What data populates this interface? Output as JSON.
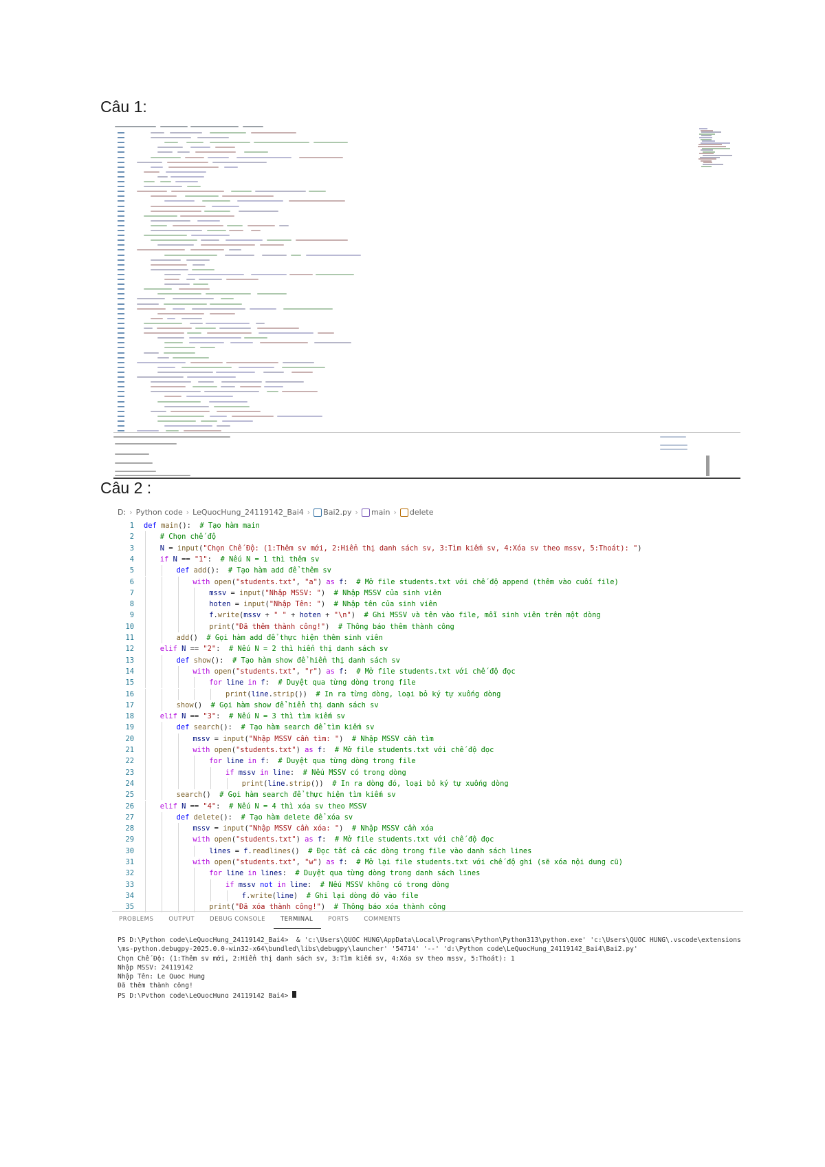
{
  "headings": {
    "q1": "Câu 1:",
    "q2": "Câu 2 :"
  },
  "editor2": {
    "breadcrumb": [
      "D:",
      "Python code",
      "LeQuocHung_24119142_Bai4",
      "Bai2.py",
      "main",
      "delete"
    ],
    "lines": [
      {
        "n": "1",
        "indent": 0,
        "code": [
          [
            "kw",
            "def "
          ],
          [
            "fn",
            "main"
          ],
          [
            "",
            "():  "
          ],
          [
            "cm",
            "# Tạo hàm main"
          ]
        ]
      },
      {
        "n": "2",
        "indent": 1,
        "code": [
          [
            "cm",
            "# Chọn chế độ"
          ]
        ]
      },
      {
        "n": "3",
        "indent": 1,
        "code": [
          [
            "var",
            "N"
          ],
          [
            "",
            " = "
          ],
          [
            "fn",
            "input"
          ],
          [
            "",
            "("
          ],
          [
            "str",
            "\"Chọn Chế Độ: (1:Thêm sv mới, 2:Hiển thị danh sách sv, 3:Tìm kiếm sv, 4:Xóa sv theo mssv, 5:Thoát): \""
          ],
          [
            "",
            ")"
          ]
        ]
      },
      {
        "n": "4",
        "indent": 1,
        "code": [
          [
            "kw2",
            "if "
          ],
          [
            "var",
            "N"
          ],
          [
            "",
            " == "
          ],
          [
            "str",
            "\"1\""
          ],
          [
            "",
            ":  "
          ],
          [
            "cm",
            "# Nếu N = 1 thì thêm sv"
          ]
        ]
      },
      {
        "n": "5",
        "indent": 2,
        "code": [
          [
            "kw",
            "def "
          ],
          [
            "fn",
            "add"
          ],
          [
            "",
            "():  "
          ],
          [
            "cm",
            "# Tạo hàm add để thêm sv"
          ]
        ]
      },
      {
        "n": "6",
        "indent": 3,
        "code": [
          [
            "kw2",
            "with "
          ],
          [
            "fn",
            "open"
          ],
          [
            "",
            "("
          ],
          [
            "str",
            "\"students.txt\""
          ],
          [
            "",
            ", "
          ],
          [
            "str",
            "\"a\""
          ],
          [
            "",
            ") "
          ],
          [
            "kw2",
            "as "
          ],
          [
            "var",
            "f"
          ],
          [
            "",
            ":  "
          ],
          [
            "cm",
            "# Mở file students.txt với chế độ append (thêm vào cuối file)"
          ]
        ]
      },
      {
        "n": "7",
        "indent": 4,
        "code": [
          [
            "var",
            "mssv"
          ],
          [
            "",
            " = "
          ],
          [
            "fn",
            "input"
          ],
          [
            "",
            "("
          ],
          [
            "str",
            "\"Nhập MSSV: \""
          ],
          [
            "",
            ")  "
          ],
          [
            "cm",
            "# Nhập MSSV của sinh viên"
          ]
        ]
      },
      {
        "n": "8",
        "indent": 4,
        "code": [
          [
            "var",
            "hoten"
          ],
          [
            "",
            " = "
          ],
          [
            "fn",
            "input"
          ],
          [
            "",
            "("
          ],
          [
            "str",
            "\"Nhập Tên: \""
          ],
          [
            "",
            ")  "
          ],
          [
            "cm",
            "# Nhập tên của sinh viên"
          ]
        ]
      },
      {
        "n": "9",
        "indent": 4,
        "code": [
          [
            "var",
            "f"
          ],
          [
            "",
            "."
          ],
          [
            "fn",
            "write"
          ],
          [
            "",
            "("
          ],
          [
            "var",
            "mssv"
          ],
          [
            "",
            " + "
          ],
          [
            "str",
            "\" \""
          ],
          [
            "",
            " + "
          ],
          [
            "var",
            "hoten"
          ],
          [
            "",
            " + "
          ],
          [
            "str",
            "\"\\n\""
          ],
          [
            "",
            ")  "
          ],
          [
            "cm",
            "# Ghi MSSV và tên vào file, mỗi sinh viên trên một dòng"
          ]
        ]
      },
      {
        "n": "10",
        "indent": 4,
        "code": [
          [
            "fn",
            "print"
          ],
          [
            "",
            "("
          ],
          [
            "str",
            "\"Đã thêm thành công!\""
          ],
          [
            "",
            ")  "
          ],
          [
            "cm",
            "# Thông báo thêm thành công"
          ]
        ]
      },
      {
        "n": "11",
        "indent": 2,
        "code": [
          [
            "fn",
            "add"
          ],
          [
            "",
            "()  "
          ],
          [
            "cm",
            "# Gọi hàm add để thực hiện thêm sinh viên"
          ]
        ]
      },
      {
        "n": "12",
        "indent": 1,
        "code": [
          [
            "kw2",
            "elif "
          ],
          [
            "var",
            "N"
          ],
          [
            "",
            " == "
          ],
          [
            "str",
            "\"2\""
          ],
          [
            "",
            ":  "
          ],
          [
            "cm",
            "# Nếu N = 2 thì hiển thị danh sách sv"
          ]
        ]
      },
      {
        "n": "13",
        "indent": 2,
        "code": [
          [
            "kw",
            "def "
          ],
          [
            "fn",
            "show"
          ],
          [
            "",
            "():  "
          ],
          [
            "cm",
            "# Tạo hàm show để hiển thị danh sách sv"
          ]
        ]
      },
      {
        "n": "14",
        "indent": 3,
        "code": [
          [
            "kw2",
            "with "
          ],
          [
            "fn",
            "open"
          ],
          [
            "",
            "("
          ],
          [
            "str",
            "\"students.txt\""
          ],
          [
            "",
            ", "
          ],
          [
            "str",
            "\"r\""
          ],
          [
            "",
            ") "
          ],
          [
            "kw2",
            "as "
          ],
          [
            "var",
            "f"
          ],
          [
            "",
            ":  "
          ],
          [
            "cm",
            "# Mở file students.txt với chế độ đọc"
          ]
        ]
      },
      {
        "n": "15",
        "indent": 4,
        "code": [
          [
            "kw2",
            "for "
          ],
          [
            "var",
            "line"
          ],
          [
            "kw2",
            " in "
          ],
          [
            "var",
            "f"
          ],
          [
            "",
            ":  "
          ],
          [
            "cm",
            "# Duyệt qua từng dòng trong file"
          ]
        ]
      },
      {
        "n": "16",
        "indent": 5,
        "code": [
          [
            "fn",
            "print"
          ],
          [
            "",
            "("
          ],
          [
            "var",
            "line"
          ],
          [
            "",
            "."
          ],
          [
            "fn",
            "strip"
          ],
          [
            "",
            "())  "
          ],
          [
            "cm",
            "# In ra từng dòng, loại bỏ ký tự xuống dòng"
          ]
        ]
      },
      {
        "n": "17",
        "indent": 2,
        "code": [
          [
            "fn",
            "show"
          ],
          [
            "",
            "()  "
          ],
          [
            "cm",
            "# Gọi hàm show để hiển thị danh sách sv"
          ]
        ]
      },
      {
        "n": "18",
        "indent": 1,
        "code": [
          [
            "kw2",
            "elif "
          ],
          [
            "var",
            "N"
          ],
          [
            "",
            " == "
          ],
          [
            "str",
            "\"3\""
          ],
          [
            "",
            ":  "
          ],
          [
            "cm",
            "# Nếu N = 3 thì tìm kiếm sv"
          ]
        ]
      },
      {
        "n": "19",
        "indent": 2,
        "code": [
          [
            "kw",
            "def "
          ],
          [
            "fn",
            "search"
          ],
          [
            "",
            "():  "
          ],
          [
            "cm",
            "# Tạo hàm search để tìm kiếm sv"
          ]
        ]
      },
      {
        "n": "20",
        "indent": 3,
        "code": [
          [
            "var",
            "mssv"
          ],
          [
            "",
            " = "
          ],
          [
            "fn",
            "input"
          ],
          [
            "",
            "("
          ],
          [
            "str",
            "\"Nhập MSSV cần tìm: \""
          ],
          [
            "",
            ")  "
          ],
          [
            "cm",
            "# Nhập MSSV cần tìm"
          ]
        ]
      },
      {
        "n": "21",
        "indent": 3,
        "code": [
          [
            "kw2",
            "with "
          ],
          [
            "fn",
            "open"
          ],
          [
            "",
            "("
          ],
          [
            "str",
            "\"students.txt\""
          ],
          [
            "",
            ") "
          ],
          [
            "kw2",
            "as "
          ],
          [
            "var",
            "f"
          ],
          [
            "",
            ":  "
          ],
          [
            "cm",
            "# Mở file students.txt với chế độ đọc"
          ]
        ]
      },
      {
        "n": "22",
        "indent": 4,
        "code": [
          [
            "kw2",
            "for "
          ],
          [
            "var",
            "line"
          ],
          [
            "kw2",
            " in "
          ],
          [
            "var",
            "f"
          ],
          [
            "",
            ":  "
          ],
          [
            "cm",
            "# Duyệt qua từng dòng trong file"
          ]
        ]
      },
      {
        "n": "23",
        "indent": 5,
        "code": [
          [
            "kw2",
            "if "
          ],
          [
            "var",
            "mssv"
          ],
          [
            "kw2",
            " in "
          ],
          [
            "var",
            "line"
          ],
          [
            "",
            ":  "
          ],
          [
            "cm",
            "# Nếu MSSV có trong dòng"
          ]
        ]
      },
      {
        "n": "24",
        "indent": 6,
        "code": [
          [
            "fn",
            "print"
          ],
          [
            "",
            "("
          ],
          [
            "var",
            "line"
          ],
          [
            "",
            "."
          ],
          [
            "fn",
            "strip"
          ],
          [
            "",
            "())  "
          ],
          [
            "cm",
            "# In ra dòng đó, loại bỏ ký tự xuống dòng"
          ]
        ]
      },
      {
        "n": "25",
        "indent": 2,
        "code": [
          [
            "fn",
            "search"
          ],
          [
            "",
            "()  "
          ],
          [
            "cm",
            "# Gọi hàm search để thực hiện tìm kiếm sv"
          ]
        ]
      },
      {
        "n": "26",
        "indent": 1,
        "code": [
          [
            "kw2",
            "elif "
          ],
          [
            "var",
            "N"
          ],
          [
            "",
            " == "
          ],
          [
            "str",
            "\"4\""
          ],
          [
            "",
            ":  "
          ],
          [
            "cm",
            "# Nếu N = 4 thì xóa sv theo MSSV"
          ]
        ]
      },
      {
        "n": "27",
        "indent": 2,
        "code": [
          [
            "kw",
            "def "
          ],
          [
            "fn",
            "delete"
          ],
          [
            "",
            "():  "
          ],
          [
            "cm",
            "# Tạo hàm delete để xóa sv"
          ]
        ]
      },
      {
        "n": "28",
        "indent": 3,
        "code": [
          [
            "var",
            "mssv"
          ],
          [
            "",
            " = "
          ],
          [
            "fn",
            "input"
          ],
          [
            "",
            "("
          ],
          [
            "str",
            "\"Nhập MSSV cần xóa: \""
          ],
          [
            "",
            ")  "
          ],
          [
            "cm",
            "# Nhập MSSV cần xóa"
          ]
        ]
      },
      {
        "n": "29",
        "indent": 3,
        "code": [
          [
            "kw2",
            "with "
          ],
          [
            "fn",
            "open"
          ],
          [
            "",
            "("
          ],
          [
            "str",
            "\"students.txt\""
          ],
          [
            "",
            ") "
          ],
          [
            "kw2",
            "as "
          ],
          [
            "var",
            "f"
          ],
          [
            "",
            ":  "
          ],
          [
            "cm",
            "# Mở file students.txt với chế độ đọc"
          ]
        ]
      },
      {
        "n": "30",
        "indent": 4,
        "code": [
          [
            "var",
            "lines"
          ],
          [
            "",
            " = "
          ],
          [
            "var",
            "f"
          ],
          [
            "",
            "."
          ],
          [
            "fn",
            "readlines"
          ],
          [
            "",
            "()  "
          ],
          [
            "cm",
            "# Đọc tất cả các dòng trong file vào danh sách lines"
          ]
        ]
      },
      {
        "n": "31",
        "indent": 3,
        "code": [
          [
            "kw2",
            "with "
          ],
          [
            "fn",
            "open"
          ],
          [
            "",
            "("
          ],
          [
            "str",
            "\"students.txt\""
          ],
          [
            "",
            ", "
          ],
          [
            "str",
            "\"w\""
          ],
          [
            "",
            ") "
          ],
          [
            "kw2",
            "as "
          ],
          [
            "var",
            "f"
          ],
          [
            "",
            ":  "
          ],
          [
            "cm",
            "# Mở lại file students.txt với chế độ ghi (sẽ xóa nội dung cũ)"
          ]
        ]
      },
      {
        "n": "32",
        "indent": 4,
        "code": [
          [
            "kw2",
            "for "
          ],
          [
            "var",
            "line"
          ],
          [
            "kw2",
            " in "
          ],
          [
            "var",
            "lines"
          ],
          [
            "",
            ":  "
          ],
          [
            "cm",
            "# Duyệt qua từng dòng trong danh sách lines"
          ]
        ]
      },
      {
        "n": "33",
        "indent": 5,
        "code": [
          [
            "kw2",
            "if "
          ],
          [
            "var",
            "mssv"
          ],
          [
            "kw",
            " not "
          ],
          [
            "kw2",
            "in "
          ],
          [
            "var",
            "line"
          ],
          [
            "",
            ":  "
          ],
          [
            "cm",
            "# Nếu MSSV không có trong dòng"
          ]
        ]
      },
      {
        "n": "34",
        "indent": 6,
        "code": [
          [
            "var",
            "f"
          ],
          [
            "",
            "."
          ],
          [
            "fn",
            "write"
          ],
          [
            "",
            "("
          ],
          [
            "var",
            "line"
          ],
          [
            "",
            ")  "
          ],
          [
            "cm",
            "# Ghi lại dòng đó vào file"
          ]
        ]
      },
      {
        "n": "35",
        "indent": 4,
        "code": [
          [
            "fn",
            "print"
          ],
          [
            "",
            "("
          ],
          [
            "str",
            "\"Đã xóa thành công!\""
          ],
          [
            "",
            ")  "
          ],
          [
            "cm",
            "# Thông báo xóa thành công"
          ]
        ]
      }
    ],
    "panel_tabs": [
      "PROBLEMS",
      "OUTPUT",
      "DEBUG CONSOLE",
      "TERMINAL",
      "PORTS",
      "COMMENTS"
    ],
    "active_tab": "TERMINAL",
    "terminal": [
      "PS D:\\Python code\\LeQuocHung_24119142_Bai4>  & 'c:\\Users\\QUOC HUNG\\AppData\\Local\\Programs\\Python\\Python313\\python.exe' 'c:\\Users\\QUOC HUNG\\.vscode\\extensions\\ms-python.debugpy-2025.0.0-win32-x64\\bundled\\libs\\debugpy\\launcher' '54714' '--' 'd:\\Python code\\LeQuocHung_24119142_Bai4\\Bai2.py'",
      "Chọn Chế Độ: (1:Thêm sv mới, 2:Hiển thị danh sách sv, 3:Tìm kiếm sv, 4:Xóa sv theo mssv, 5:Thoát): 1",
      "Nhập MSSV: 24119142",
      "Nhập Tên: Le Quoc Hung",
      "Đã thêm thành công!",
      "PS D:\\Python code\\LeQuocHung_24119142_Bai4> "
    ]
  },
  "colors": {
    "keyword": "#0000ff",
    "control": "#af00db",
    "function": "#795e26",
    "string": "#a31515",
    "comment": "#008000",
    "variable": "#001080",
    "line_number": "#237893"
  }
}
